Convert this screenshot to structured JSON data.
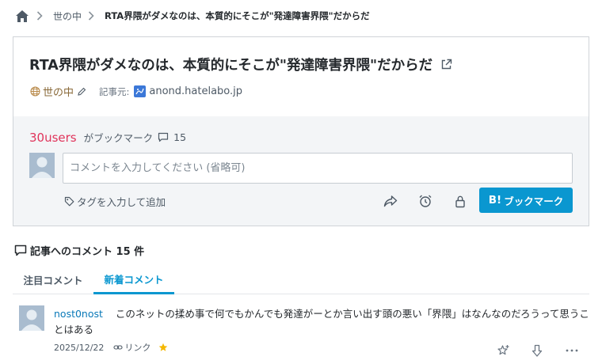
{
  "breadcrumb": {
    "category": "世の中",
    "current": "RTA界隈がダメなのは、本質的にそこが\"発達障害界隈\"だからだ"
  },
  "entry": {
    "title": "RTA界隈がダメなのは、本質的にそこが\"発達障害界隈\"だからだ",
    "category": "世の中",
    "source_label": "記事元:",
    "source_domain": "anond.hatelabo.jp"
  },
  "bookmark_panel": {
    "users_count": "30users",
    "users_suffix": "がブックマーク",
    "comment_count": "15",
    "comment_placeholder": "コメントを入力してください (省略可)",
    "tag_placeholder": "タグを入力して追加",
    "bookmark_button": "ブックマーク",
    "bookmark_button_mark": "B!"
  },
  "comments": {
    "heading": "記事へのコメント 15 件",
    "tabs": [
      {
        "label": "注目コメント",
        "active": false
      },
      {
        "label": "新着コメント",
        "active": true
      }
    ],
    "items": [
      {
        "user": "nost0nost",
        "text": "このネットの揉め事で何でもかんでも発達がーとか言い出す頭の悪い「界隈」はなんなのだろうって思うことはある",
        "date": "2025/12/22",
        "link_label": "リンク"
      }
    ]
  },
  "colors": {
    "accent": "#0a97d0",
    "users_count": "#e0345b",
    "star": "#f5b800"
  },
  "icons": [
    "home-icon",
    "chevron-right-icon",
    "external-link-icon",
    "globe-icon",
    "pencil-icon",
    "hatena-favicon",
    "comment-bubble-icon",
    "avatar-icon",
    "tag-icon",
    "share-icon",
    "alarm-clock-icon",
    "lock-icon",
    "link-icon",
    "star-icon",
    "add-star-icon",
    "arrow-down-icon",
    "more-icon"
  ]
}
